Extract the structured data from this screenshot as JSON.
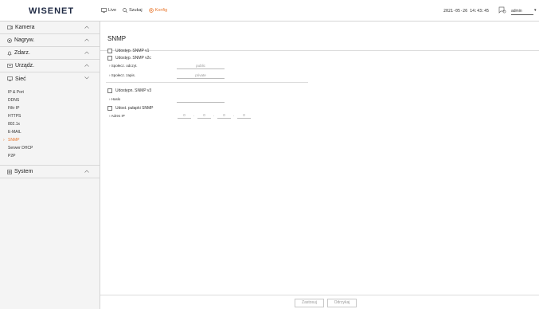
{
  "app": {
    "logo": "WISENET"
  },
  "topnav": {
    "live": "Live",
    "search": "Szukaj",
    "config": "Konfig"
  },
  "header": {
    "datetime": "2021-05-26 14:43:45",
    "user": "admin"
  },
  "sidebar": {
    "sections": [
      {
        "label": "Kamera",
        "icon": "camera-icon"
      },
      {
        "label": "Nagryw.",
        "icon": "record-icon"
      },
      {
        "label": "Zdarz.",
        "icon": "bell-icon"
      },
      {
        "label": "Urządz.",
        "icon": "device-icon"
      },
      {
        "label": "Sieć",
        "icon": "monitor-icon"
      },
      {
        "label": "System",
        "icon": "system-icon"
      }
    ],
    "network_items": [
      "IP & Port",
      "DDNS",
      "Filtr IP",
      "HTTPS",
      "802.1x",
      "E-MAIL",
      "SNMP",
      "Serwer DHCP",
      "P2P"
    ],
    "active_item": "SNMP"
  },
  "main": {
    "title": "SNMP",
    "snmp_v1_label": "Udostęp. SNMP v1",
    "snmp_v2c_label": "Udostęp. SNMP v2c",
    "read_community_label": "Społecz. odczyt.",
    "read_community_value": "public",
    "write_community_label": "Społecz. zapis.",
    "write_community_value": "private",
    "snmp_v3_label": "Udostępn. SNMP v3",
    "password_label": "Hasło",
    "password_value": "",
    "trap_label": "Udost. pułapki SNMP",
    "ip_label": "Adres IP",
    "ip_octets": [
      "0",
      "0",
      "0",
      "0"
    ]
  },
  "footer": {
    "apply": "Zastosuj",
    "cancel": "Odrzykaj"
  },
  "colors": {
    "accent": "#e8772e",
    "sidebar_bg": "#f4f4f4",
    "logo": "#1f2a44"
  }
}
